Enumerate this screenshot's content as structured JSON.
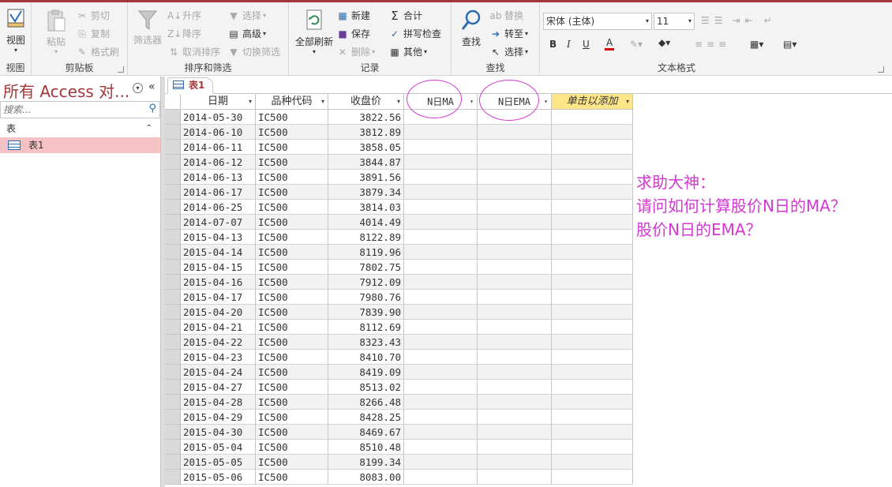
{
  "ribbon": {
    "view": {
      "label": "视图",
      "group": "视图"
    },
    "clipboard": {
      "paste": "粘贴",
      "cut": "剪切",
      "copy": "复制",
      "format_painter": "格式刷",
      "group": "剪贴板"
    },
    "sort_filter": {
      "filter": "筛选器",
      "ascending": "升序",
      "descending": "降序",
      "remove_sort": "取消排序",
      "selection": "选择",
      "advanced": "高级",
      "toggle_filter": "切换筛选",
      "group": "排序和筛选"
    },
    "records": {
      "refresh_all": "全部刷新",
      "new": "新建",
      "save": "保存",
      "delete": "删除",
      "totals": "合计",
      "spelling": "拼写检查",
      "more": "其他",
      "group": "记录"
    },
    "find": {
      "find": "查找",
      "replace": "替换",
      "goto": "转至",
      "select": "选择",
      "group": "查找"
    },
    "text_format": {
      "font": "宋体 (主体)",
      "size": "11",
      "bold": "B",
      "italic": "I",
      "underline": "U",
      "font_color_letter": "A",
      "group": "文本格式"
    }
  },
  "nav": {
    "title": "所有 Access 对...",
    "search_placeholder": "搜索...",
    "group_label": "表",
    "items": [
      {
        "label": "表1"
      }
    ]
  },
  "sheet": {
    "tab": "表1",
    "columns": [
      "日期",
      "品种代码",
      "收盘价",
      "N日MA",
      "N日EMA",
      "单击以添加"
    ],
    "rows": [
      [
        "2014-05-30",
        "IC500",
        "3822.56"
      ],
      [
        "2014-06-10",
        "IC500",
        "3812.89"
      ],
      [
        "2014-06-11",
        "IC500",
        "3858.05"
      ],
      [
        "2014-06-12",
        "IC500",
        "3844.87"
      ],
      [
        "2014-06-13",
        "IC500",
        "3891.56"
      ],
      [
        "2014-06-17",
        "IC500",
        "3879.34"
      ],
      [
        "2014-06-25",
        "IC500",
        "3814.03"
      ],
      [
        "2014-07-07",
        "IC500",
        "4014.49"
      ],
      [
        "2015-04-13",
        "IC500",
        "8122.89"
      ],
      [
        "2015-04-14",
        "IC500",
        "8119.96"
      ],
      [
        "2015-04-15",
        "IC500",
        "7802.75"
      ],
      [
        "2015-04-16",
        "IC500",
        "7912.09"
      ],
      [
        "2015-04-17",
        "IC500",
        "7980.76"
      ],
      [
        "2015-04-20",
        "IC500",
        "7839.90"
      ],
      [
        "2015-04-21",
        "IC500",
        "8112.69"
      ],
      [
        "2015-04-22",
        "IC500",
        "8323.43"
      ],
      [
        "2015-04-23",
        "IC500",
        "8410.70"
      ],
      [
        "2015-04-24",
        "IC500",
        "8419.09"
      ],
      [
        "2015-04-27",
        "IC500",
        "8513.02"
      ],
      [
        "2015-04-28",
        "IC500",
        "8266.48"
      ],
      [
        "2015-04-29",
        "IC500",
        "8428.25"
      ],
      [
        "2015-04-30",
        "IC500",
        "8469.67"
      ],
      [
        "2015-05-04",
        "IC500",
        "8510.48"
      ],
      [
        "2015-05-05",
        "IC500",
        "8199.34"
      ],
      [
        "2015-05-06",
        "IC500",
        "8083.00"
      ]
    ]
  },
  "annotation": {
    "lines": [
      "求助大神：",
      "请问如何计算股价N日的MA？",
      "股价N日的EMA？"
    ],
    "color": "#d437d4"
  },
  "colors": {
    "accent": "#a4373a",
    "highlight_header": "#fde58a",
    "nav_selected": "#f7c2c4"
  }
}
